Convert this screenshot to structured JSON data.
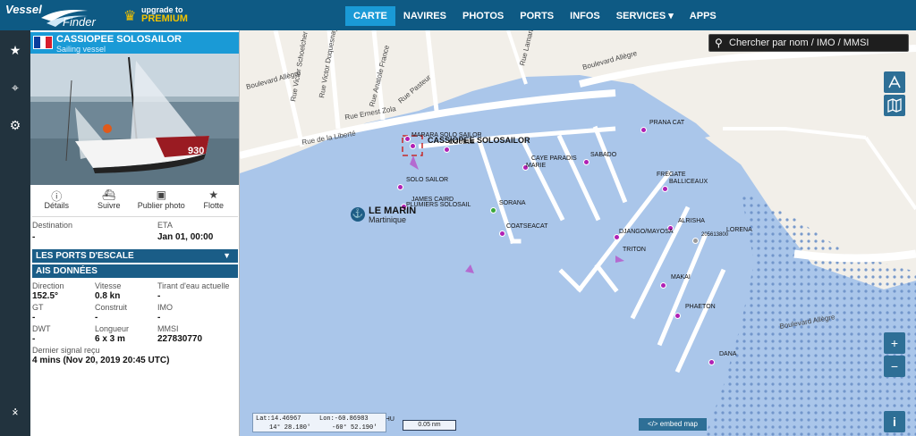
{
  "brand": {
    "line1": "Vessel",
    "line2": "Finder",
    "upgrade_small": "upgrade to",
    "upgrade_big": "PREMIUM"
  },
  "nav": [
    {
      "label": "CARTE",
      "active": true
    },
    {
      "label": "NAVIRES",
      "active": false
    },
    {
      "label": "PHOTOS",
      "active": false
    },
    {
      "label": "PORTS",
      "active": false
    },
    {
      "label": "INFOS",
      "active": false
    },
    {
      "label": "SERVICES ▾",
      "active": false
    },
    {
      "label": "APPS",
      "active": false
    }
  ],
  "rail": [
    {
      "icon": "star-icon",
      "glyph": "★"
    },
    {
      "icon": "map-pin-icon",
      "glyph": "⌖"
    },
    {
      "icon": "gear-icon",
      "glyph": "⚙"
    },
    {
      "icon": "antenna-icon",
      "glyph": "⨰"
    }
  ],
  "vessel": {
    "name": "CASSIOPEE SOLOSAILOR",
    "type": "Sailing vessel",
    "flag_colors": [
      "#0a3d9c",
      "#ffffff",
      "#d81e2c"
    ],
    "sail_number": "930",
    "actions": [
      {
        "icon": "info-icon",
        "glyph": "ⓘ",
        "label": "Détails"
      },
      {
        "icon": "ship-icon",
        "glyph": "⛴",
        "label": "Suivre"
      },
      {
        "icon": "camera-icon",
        "glyph": "▣",
        "label": "Publier photo"
      },
      {
        "icon": "star-icon",
        "glyph": "★",
        "label": "Flotte"
      }
    ],
    "destination_label": "Destination",
    "destination_value": "-",
    "eta_label": "ETA",
    "eta_value": "Jan 01, 00:00",
    "ports_section": "LES PORTS D'ESCALE",
    "ais_section": "AIS DONNÉES",
    "ais": {
      "direction_label": "Direction",
      "direction": "152.5°",
      "speed_label": "Vitesse",
      "speed": "0.8 kn",
      "draft_label": "Tirant d'eau actuelle",
      "draft": "-",
      "gt_label": "GT",
      "gt": "-",
      "built_label": "Construit",
      "built": "-",
      "imo_label": "IMO",
      "imo": "-",
      "dwt_label": "DWT",
      "dwt": "-",
      "length_label": "Longueur",
      "length": "6 x 3 m",
      "mmsi_label": "MMSI",
      "mmsi": "227830770",
      "last_label": "Dernier signal reçu",
      "last": "4 mins (Nov 20, 2019 20:45 UTC)"
    }
  },
  "map": {
    "search_placeholder": "Chercher par nom / IMO / MMSI",
    "streets": [
      "Rue Victor Schoelcher",
      "Rue Victor Duquesnay",
      "Rue Anatole France",
      "Rue Pasteur",
      "Rue Ernest Zola",
      "Rue de la Liberté",
      "Boulevard Allègre",
      "Rue Lamartine",
      "Boulevard Allègre",
      "Boulevard Allègre"
    ],
    "town_name": "LE MARIN",
    "town_sub": "Martinique",
    "selected_label": "CASSIOPEE SOLOSAILOR",
    "vessel_labels": [
      "MARARA SOLO SAILOR",
      "DOUBLE",
      "CAYE PARADIS",
      "SABADO",
      "MARIE",
      "PRANA CAT",
      "FREGATE",
      "BALLICEAUX",
      "SOLO SAILOR",
      "JAMES CAIRD",
      "PLUMIERS SOLOSAIL",
      "SORANA",
      "COATSEACAT",
      "ALRISHA",
      "205613800",
      "LORENA",
      "DJANGO/MAYOSA",
      "TRITON",
      "MAKAI",
      "PHAETON",
      "DANA",
      "NUSHU"
    ],
    "lat": "Lat:14.46967",
    "lon": "Lon:-60.86983",
    "lat_dms": "14° 28.180'",
    "lon_dms": "-60° 52.190'",
    "scale": "0.05 nm",
    "embed": "</> embed map",
    "zoom_in": "+",
    "zoom_out": "−",
    "info": "i"
  }
}
